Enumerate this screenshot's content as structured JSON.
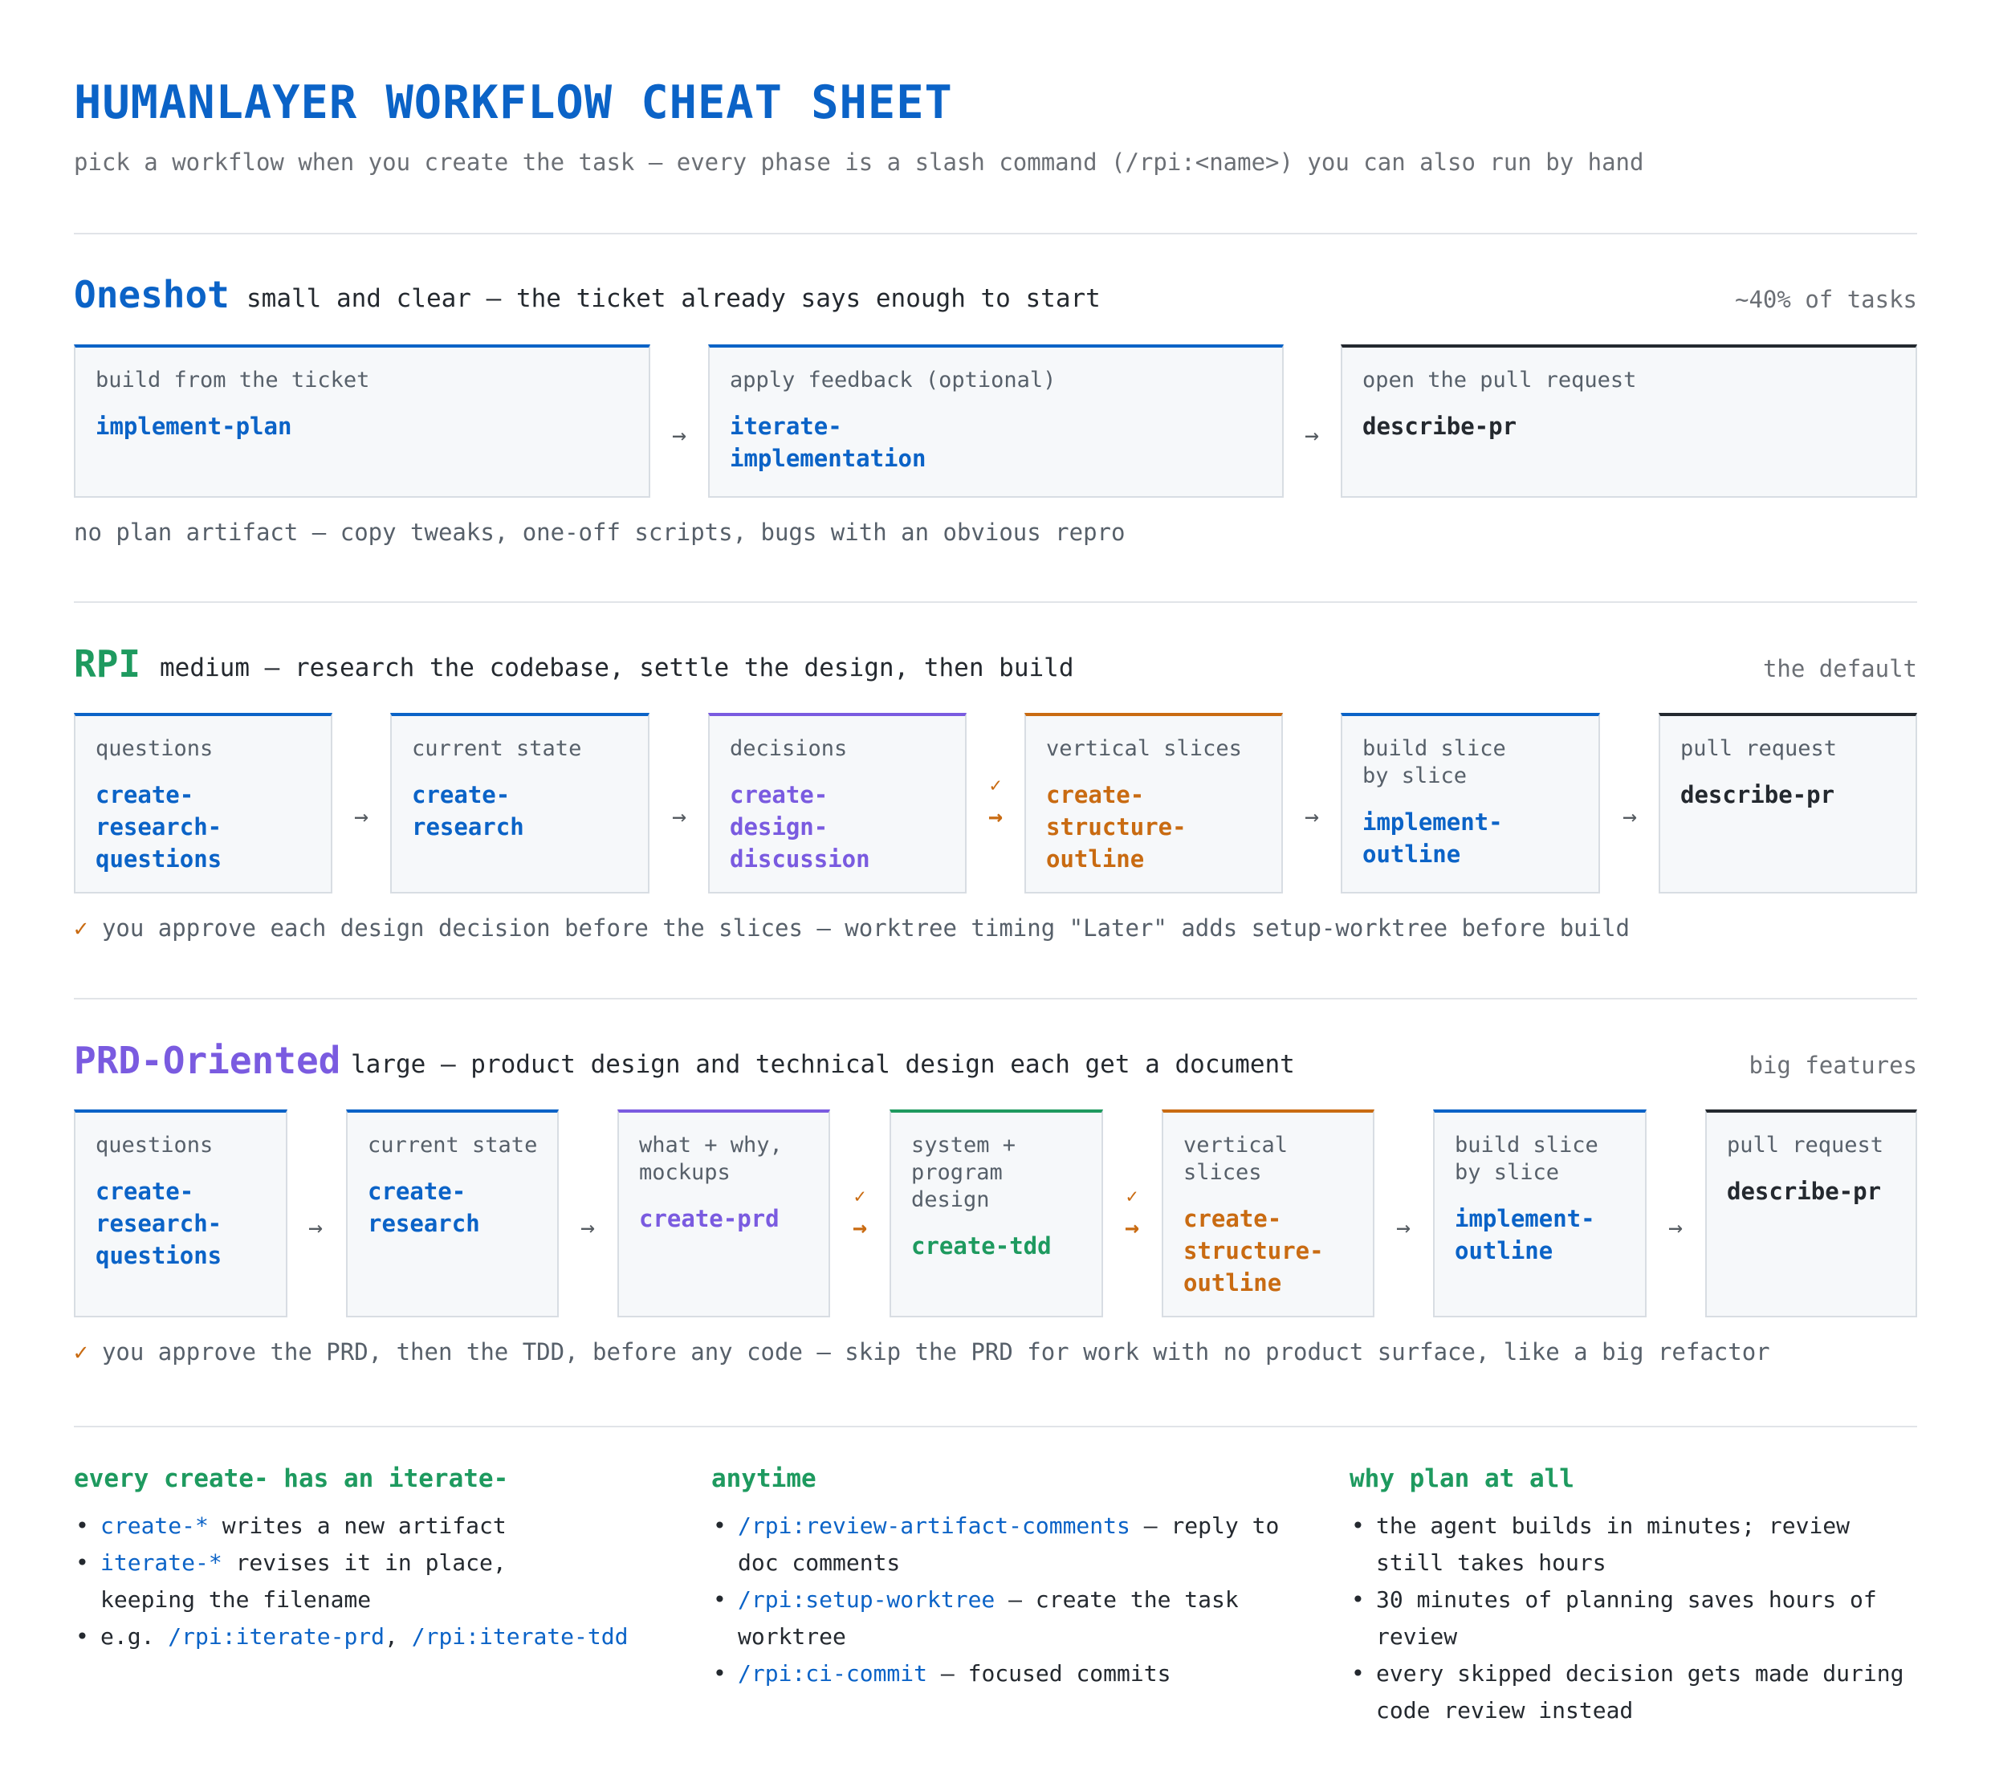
{
  "header": {
    "title": "HUMANLAYER WORKFLOW CHEAT SHEET",
    "subtitle": "pick a workflow when you create the task — every phase is a slash command (/rpi:<name>) you can also run by hand"
  },
  "colors": {
    "blue": "#0b63c7",
    "green": "#1e9a5f",
    "purple": "#7a5be0",
    "orange": "#c96b12",
    "dark": "#24292f"
  },
  "oneshot": {
    "name": "Oneshot",
    "desc": "small and clear — the ticket already says enough to start",
    "tag": "~40% of tasks",
    "steps": [
      {
        "label": "build from the ticket",
        "command": "implement-plan"
      },
      {
        "label": "apply feedback (optional)",
        "command": "iterate-implementation"
      },
      {
        "label": "open the pull request",
        "command": "describe-pr"
      }
    ],
    "note": "no plan artifact — copy tweaks, one-off scripts, bugs with an obvious repro"
  },
  "rpi": {
    "name": "RPI",
    "desc": "medium — research the codebase, settle the design, then build",
    "tag": "the default",
    "steps": [
      {
        "label": "questions",
        "command": "create-research-questions"
      },
      {
        "label": "current state",
        "command": "create-research"
      },
      {
        "label": "decisions",
        "command": "create-design-discussion"
      },
      {
        "label": "vertical slices",
        "command": "create-structure-outline"
      },
      {
        "label": "build slice by slice",
        "command": "implement-outline"
      },
      {
        "label": "pull request",
        "command": "describe-pr"
      }
    ],
    "arrow": "→",
    "check": "✓",
    "note": "you approve each design decision before the slices — worktree timing \"Later\" adds setup-worktree before build"
  },
  "prd": {
    "name": "PRD-Oriented",
    "desc": "large — product design and technical design each get a document",
    "tag": "big features",
    "steps": [
      {
        "label": "questions",
        "command": "create-research-questions"
      },
      {
        "label": "current state",
        "command": "create-research"
      },
      {
        "label": "what + why, mockups",
        "command": "create-prd"
      },
      {
        "label": "system + program design",
        "command": "create-tdd"
      },
      {
        "label": "vertical slices",
        "command": "create-structure-outline"
      },
      {
        "label": "build slice by slice",
        "command": "implement-outline"
      },
      {
        "label": "pull request",
        "command": "describe-pr"
      }
    ],
    "note": "you approve the PRD, then the TDD, before any code — skip the PRD for work with no product surface, like a big refactor"
  },
  "footer": {
    "col1": {
      "title": "every create- has an iterate-",
      "items": [
        {
          "code": "create-*",
          "text": " writes a new artifact"
        },
        {
          "code": "iterate-*",
          "text": " revises it in place, keeping the filename"
        },
        {
          "prefix": "e.g. ",
          "code": "/rpi:iterate-prd",
          "sep": ", ",
          "code2": "/rpi:iterate-tdd"
        }
      ]
    },
    "col2": {
      "title": "anytime",
      "items": [
        {
          "code": "/rpi:review-artifact-comments",
          "text": " — reply to doc comments"
        },
        {
          "code": "/rpi:setup-worktree",
          "text": " — create the task worktree"
        },
        {
          "code": "/rpi:ci-commit",
          "text": " — focused commits"
        }
      ]
    },
    "col3": {
      "title": "why plan at all",
      "items": [
        {
          "text": "the agent builds in minutes; review still takes hours"
        },
        {
          "text": "30 minutes of planning saves hours of review"
        },
        {
          "text": "every skipped decision gets made during code review instead"
        }
      ]
    }
  }
}
